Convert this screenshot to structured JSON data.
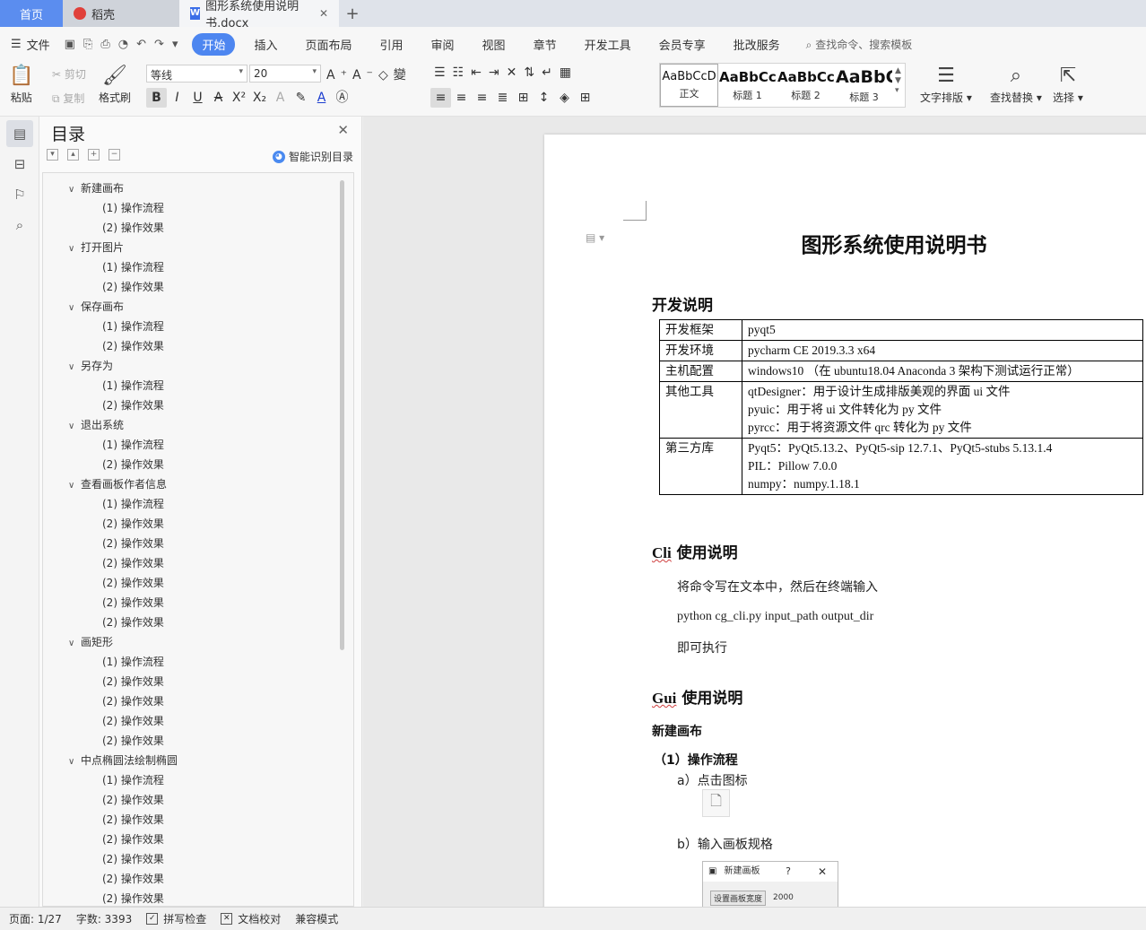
{
  "tabs": {
    "home": "首页",
    "daoke": "稻壳",
    "doc": "图形系统使用说明书.docx"
  },
  "menu": {
    "file": "文件",
    "items": [
      "开始",
      "插入",
      "页面布局",
      "引用",
      "审阅",
      "视图",
      "章节",
      "开发工具",
      "会员专享",
      "批改服务"
    ],
    "search": "查找命令、搜索模板"
  },
  "ribbon": {
    "paste": "粘贴",
    "cut": "剪切",
    "copy": "复制",
    "format_painter": "格式刷",
    "font_name": "等线",
    "font_size": "20",
    "styles": [
      {
        "sample": "AaBbCcD",
        "name": "正文"
      },
      {
        "sample": "AaBbCcI",
        "name": "标题 1"
      },
      {
        "sample": "AaBbCcD",
        "name": "标题 2"
      },
      {
        "sample": "AaBbC",
        "name": "标题 3"
      }
    ],
    "text_layout": "文字排版",
    "find_replace": "查找替换",
    "select": "选择"
  },
  "toc": {
    "title": "目录",
    "smart": "智能识别目录",
    "items": [
      {
        "level": 1,
        "text": "新建画布"
      },
      {
        "level": 2,
        "text": "(1) 操作流程"
      },
      {
        "level": 2,
        "text": "(2) 操作效果"
      },
      {
        "level": 1,
        "text": "打开图片"
      },
      {
        "level": 2,
        "text": "(1) 操作流程"
      },
      {
        "level": 2,
        "text": "(2) 操作效果"
      },
      {
        "level": 1,
        "text": "保存画布"
      },
      {
        "level": 2,
        "text": "(1) 操作流程"
      },
      {
        "level": 2,
        "text": "(2) 操作效果"
      },
      {
        "level": 1,
        "text": "另存为"
      },
      {
        "level": 2,
        "text": "(1) 操作流程"
      },
      {
        "level": 2,
        "text": "(2) 操作效果"
      },
      {
        "level": 1,
        "text": "退出系统"
      },
      {
        "level": 2,
        "text": "(1) 操作流程"
      },
      {
        "level": 2,
        "text": "(2) 操作效果"
      },
      {
        "level": 1,
        "text": "查看画板作者信息"
      },
      {
        "level": 2,
        "text": "(1) 操作流程"
      },
      {
        "level": 2,
        "text": "(2) 操作效果"
      },
      {
        "level": 2,
        "text": "(2) 操作效果"
      },
      {
        "level": 2,
        "text": "(2) 操作效果"
      },
      {
        "level": 2,
        "text": "(2) 操作效果"
      },
      {
        "level": 2,
        "text": "(2) 操作效果"
      },
      {
        "level": 2,
        "text": "(2) 操作效果"
      },
      {
        "level": 1,
        "text": "画矩形"
      },
      {
        "level": 2,
        "text": "(1) 操作流程"
      },
      {
        "level": 2,
        "text": "(2) 操作效果"
      },
      {
        "level": 2,
        "text": "(2) 操作效果"
      },
      {
        "level": 2,
        "text": "(2) 操作效果"
      },
      {
        "level": 2,
        "text": "(2) 操作效果"
      },
      {
        "level": 1,
        "text": "中点椭圆法绘制椭圆"
      },
      {
        "level": 2,
        "text": "(1) 操作流程"
      },
      {
        "level": 2,
        "text": "(2) 操作效果"
      },
      {
        "level": 2,
        "text": "(2) 操作效果"
      },
      {
        "level": 2,
        "text": "(2) 操作效果"
      },
      {
        "level": 2,
        "text": "(2) 操作效果"
      },
      {
        "level": 2,
        "text": "(2) 操作效果"
      },
      {
        "level": 2,
        "text": "(2) 操作效果"
      }
    ]
  },
  "doc": {
    "title": "图形系统使用说明书",
    "h_dev": "开发说明",
    "table": [
      {
        "k": "开发框架",
        "v": [
          "pyqt5"
        ]
      },
      {
        "k": "开发环境",
        "v": [
          "pycharm CE 2019.3.3 x64"
        ]
      },
      {
        "k": "主机配置",
        "v": [
          "windows10 （在 ubuntu18.04 Anaconda 3 架构下测试运行正常）"
        ]
      },
      {
        "k": "其他工具",
        "v": [
          "qtDesigner：用于设计生成排版美观的界面 ui 文件",
          "pyuic：用于将 ui 文件转化为 py 文件",
          "pyrcc：用于将资源文件 qrc 转化为 py 文件"
        ]
      },
      {
        "k": "第三方库",
        "v": [
          "Pyqt5：PyQt5.13.2、PyQt5-sip 12.7.1、PyQt5-stubs 5.13.1.4",
          "PIL：Pillow 7.0.0",
          "numpy：numpy.1.18.1"
        ]
      }
    ],
    "cli_prefix": "Cli",
    "cli_suffix": " 使用说明",
    "cli_p1": "将命令写在文本中，然后在终端输入",
    "cli_cmd": "python cg_cli.py input_path output_dir",
    "cli_p2": "即可执行",
    "gui_prefix": "Gui",
    "gui_suffix": " 使用说明",
    "h_new": "新建画布",
    "h_flow": "（1）操作流程",
    "step_a": "a）点击图标",
    "step_b": "b）输入画板规格",
    "dialog_title": "新建画板",
    "dialog_q": "?",
    "dialog_x": "✕",
    "dialog_btn": "设置画板宽度",
    "dialog_val": "2000"
  },
  "status": {
    "page": "页面: 1/27",
    "words": "字数: 3393",
    "spell": "拼写检查",
    "check": "文档校对",
    "compat": "兼容模式"
  }
}
